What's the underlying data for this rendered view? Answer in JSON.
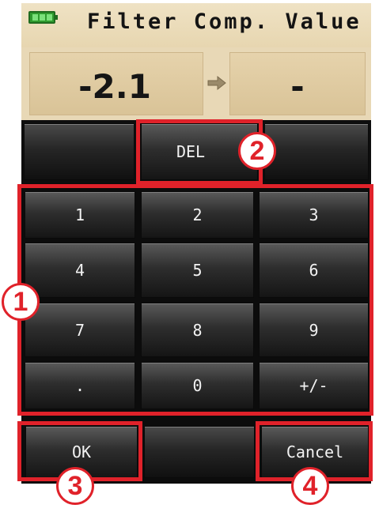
{
  "header": {
    "title": "Filter Comp. Value",
    "battery_icon": "battery-icon"
  },
  "value_display": {
    "current_value": "-2.1",
    "arrow_icon": "arrow-right-icon",
    "new_value": "-"
  },
  "actions": {
    "delete_label": "DEL",
    "ok_label": "OK",
    "cancel_label": "Cancel"
  },
  "keypad": {
    "keys": [
      "1",
      "2",
      "3",
      "4",
      "5",
      "6",
      "7",
      "8",
      "9",
      ".",
      "0",
      "+/-"
    ]
  },
  "callouts": {
    "keypad_number": "1",
    "delete_number": "2",
    "ok_number": "3",
    "cancel_number": "4"
  },
  "colors": {
    "highlight": "#e0222a",
    "header_bg": "#e7d6b0",
    "key_bg": "#2e2e2e"
  }
}
